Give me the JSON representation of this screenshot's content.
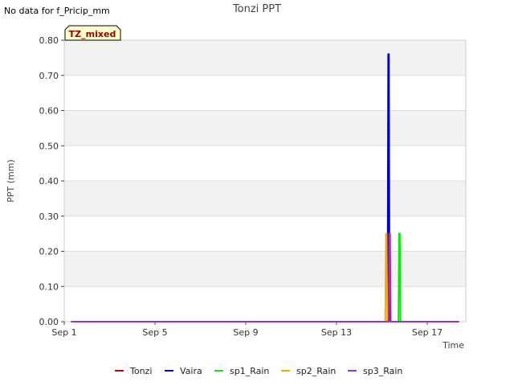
{
  "notice": "No data for f_Pricip_mm",
  "chart_data": {
    "type": "line",
    "title": "Tonzi PPT",
    "xlabel": "Time",
    "ylabel": "PPT (mm)",
    "badge": "TZ_mixed",
    "x_unit": "day of September",
    "xlim": [
      1,
      18.7
    ],
    "ylim": [
      0,
      0.8
    ],
    "x_ticks": [
      {
        "value": 1,
        "label": "Sep 1"
      },
      {
        "value": 5,
        "label": "Sep 5"
      },
      {
        "value": 9,
        "label": "Sep 9"
      },
      {
        "value": 13,
        "label": "Sep 13"
      },
      {
        "value": 17,
        "label": "Sep 17"
      }
    ],
    "y_ticks": [
      "0.00",
      "0.10",
      "0.20",
      "0.30",
      "0.40",
      "0.50",
      "0.60",
      "0.70",
      "0.80"
    ],
    "grid": true,
    "legend_position": "bottom",
    "series": [
      {
        "name": "Tonzi",
        "color": "#cc0000",
        "x": [
          1.3,
          18.4
        ],
        "y": [
          0,
          0
        ]
      },
      {
        "name": "Vaira",
        "color": "#0000cc",
        "x": [
          1.3,
          15.25,
          15.28,
          15.31,
          15.34,
          18.4
        ],
        "y": [
          0,
          0,
          0.76,
          0.76,
          0,
          0
        ]
      },
      {
        "name": "sp1_Rain",
        "color": "#00ee00",
        "x": [
          1.3,
          15.73,
          15.76,
          15.79,
          15.82,
          18.4
        ],
        "y": [
          0,
          0,
          0.25,
          0.25,
          0,
          0
        ]
      },
      {
        "name": "sp2_Rain",
        "color": "#ffa500",
        "x": [
          1.3,
          15.15,
          15.18,
          15.21,
          15.24,
          18.4
        ],
        "y": [
          0,
          0,
          0.25,
          0.25,
          0,
          0
        ]
      },
      {
        "name": "sp3_Rain",
        "color": "#9932cc",
        "x": [
          1.3,
          15.3,
          15.33,
          15.36,
          15.39,
          18.4
        ],
        "y": [
          0,
          0,
          0.25,
          0.25,
          0,
          0
        ]
      }
    ]
  }
}
